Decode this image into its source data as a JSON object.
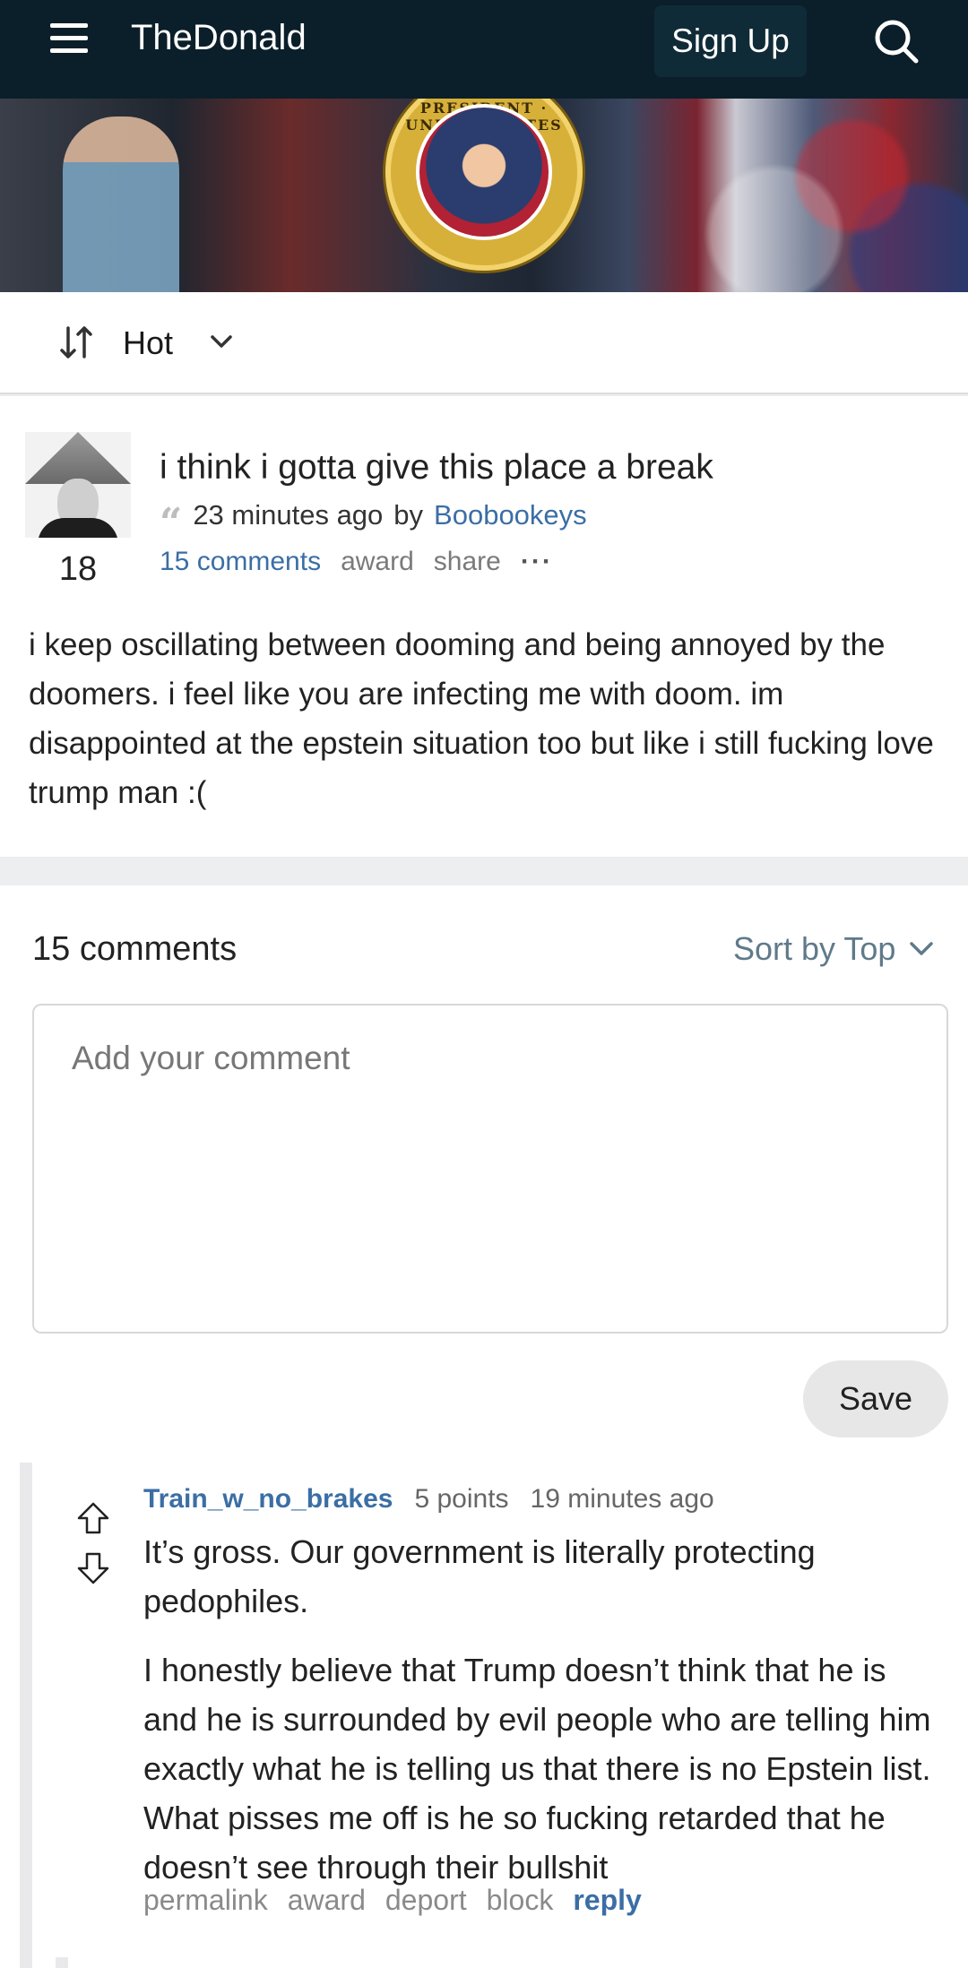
{
  "header": {
    "brand": "TheDonald",
    "signup_label": "Sign Up"
  },
  "banner": {
    "seal_text": "SEAL OF THE PRESIDENT · UNITED STATES"
  },
  "sort": {
    "label": "Hot"
  },
  "post": {
    "score": "18",
    "title": "i think i gotta give this place a break",
    "time": "23 minutes ago",
    "by": "by",
    "author": "Boobookeys",
    "actions": {
      "comments": "15 comments",
      "award": "award",
      "share": "share",
      "more": "···"
    },
    "body": "i keep oscillating between dooming and being annoyed by the doomers. i feel like you are infecting me with doom. im disappointed at the epstein situation too but like i still fucking love trump man :("
  },
  "comments": {
    "count_label": "15 comments",
    "sort_label": "Sort by Top",
    "input_placeholder": "Add your comment",
    "save_label": "Save",
    "items": [
      {
        "user": "Train_w_no_brakes",
        "points": "5 points",
        "time": "19 minutes ago",
        "quote": "It’s gross. Our government is literally protecting pedophiles.",
        "text": "I honestly believe that Trump doesn’t think that he is and he is surrounded by evil people who are telling him exactly what he is telling us that there is no Epstein list. What pisses me off is he so fucking retarded that he doesn’t see through their bullshit",
        "actions": {
          "permalink": "permalink",
          "award": "award",
          "deport": "deport",
          "block": "block",
          "reply": "reply"
        }
      }
    ]
  },
  "colors": {
    "header_bg": "#0b1f2a",
    "link": "#3b6ea5"
  }
}
